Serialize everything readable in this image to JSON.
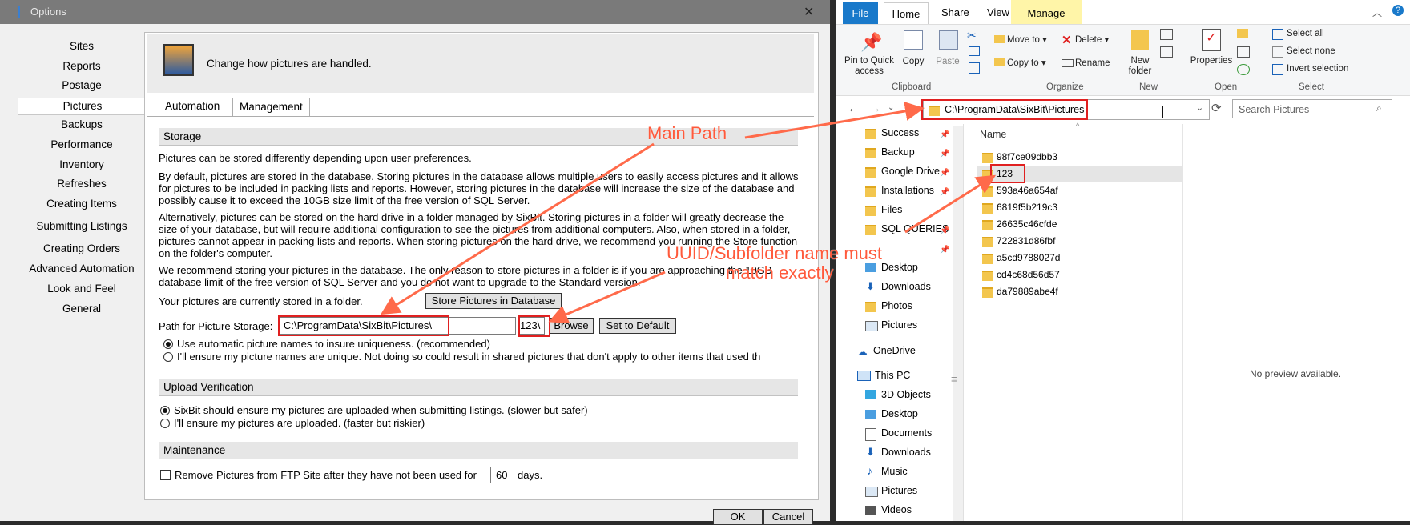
{
  "options": {
    "title": "Options",
    "nav": [
      "Sites",
      "Reports",
      "Postage",
      "Pictures",
      "Backups",
      "Performance",
      "Inventory",
      "Refreshes",
      "Creating Items",
      "Submitting Listings",
      "Creating Orders",
      "Advanced Automation",
      "Look and Feel",
      "General"
    ],
    "header_text": "Change how pictures are handled.",
    "tabs": [
      "Automation",
      "Management"
    ],
    "storage_title": "Storage",
    "p1": "Pictures can be stored differently depending upon user preferences.",
    "p2": "By default, pictures are stored in the database.  Storing pictures in the database allows multiple users to easily access pictures and it allows for pictures to be included in packing lists and reports.  However, storing pictures in the database will increase the size of the database and possibly cause it to exceed the 10GB size limit of the free version of SQL Server.",
    "p3": "Alternatively, pictures can be stored on the hard drive in a folder managed by SixBit.  Storing pictures in a folder will greatly decrease the size of your database, but will require additional configuration to see the pictures from additional computers.  Also, when stored in a folder, pictures cannot appear in packing lists and reports.  When storing pictures on the hard drive, we recommend you running the Store function on the folder's computer.",
    "p4": "We recommend storing your pictures in the database.  The only reason to store pictures in a folder is if you are approaching the 10GB database limit of the free version of SQL Server and you do not want to upgrade to the Standard version.",
    "current_store": "Your pictures are currently stored in a folder.",
    "store_db_btn": "Store Pictures in Database",
    "path_label": "Path for Picture Storage:",
    "path_value": "C:\\ProgramData\\SixBit\\Pictures\\",
    "sub_value": "123\\",
    "browse_btn": "Browse",
    "default_btn": "Set to Default",
    "radio1": "Use automatic picture names to insure uniqueness. (recommended)",
    "radio2": "I'll ensure my picture names are unique. Not doing so could result in shared pictures that don't apply to other items that used th",
    "upload_title": "Upload Verification",
    "radio3": "SixBit should ensure my pictures are uploaded when submitting listings. (slower but safer)",
    "radio4": "I'll ensure my pictures are uploaded. (faster but riskier)",
    "maint_title": "Maintenance",
    "maint_pre": "Remove Pictures from FTP Site after they have not been used for",
    "maint_days": "60",
    "maint_post": "days.",
    "ok": "OK",
    "cancel": "Cancel"
  },
  "explorer": {
    "tabs": [
      "File",
      "Home",
      "Share",
      "View",
      "Manage"
    ],
    "ribbon": {
      "pin": "Pin to Quick access",
      "copy": "Copy",
      "paste": "Paste",
      "move_to": "Move to",
      "copy_to": "Copy to",
      "delete": "Delete",
      "rename": "Rename",
      "new_folder": "New folder",
      "properties": "Properties",
      "select_all": "Select all",
      "select_none": "Select none",
      "invert": "Invert selection",
      "groups": [
        "Clipboard",
        "Organize",
        "New",
        "Open",
        "Select"
      ]
    },
    "address": "C:\\ProgramData\\SixBit\\Pictures",
    "search_placeholder": "Search Pictures",
    "nav": [
      "Success",
      "Backup",
      "Google Drive",
      "Installations",
      "Files",
      "SQL QUERIES",
      "Desktop",
      "Downloads",
      "Photos",
      "Pictures",
      "OneDrive",
      "This PC",
      "3D Objects",
      "Desktop",
      "Documents",
      "Downloads",
      "Music",
      "Pictures",
      "Videos"
    ],
    "column_name": "Name",
    "files": [
      "98f7ce09dbb3",
      "123",
      "593a46a654af",
      "6819f5b219c3",
      "26635c46cfde",
      "722831d86fbf",
      "a5cd9788027d",
      "cd4c68d56d57",
      "da79889abe4f"
    ],
    "no_preview": "No preview available."
  },
  "annotations": {
    "main_path": "Main Path",
    "uuid_line1": "UUID/Subfolder name must",
    "uuid_line2": "match exactly"
  },
  "colors": {
    "annotation": "#ff5a3c",
    "highlight": "#e02020",
    "file_tab": "#1979ca"
  }
}
